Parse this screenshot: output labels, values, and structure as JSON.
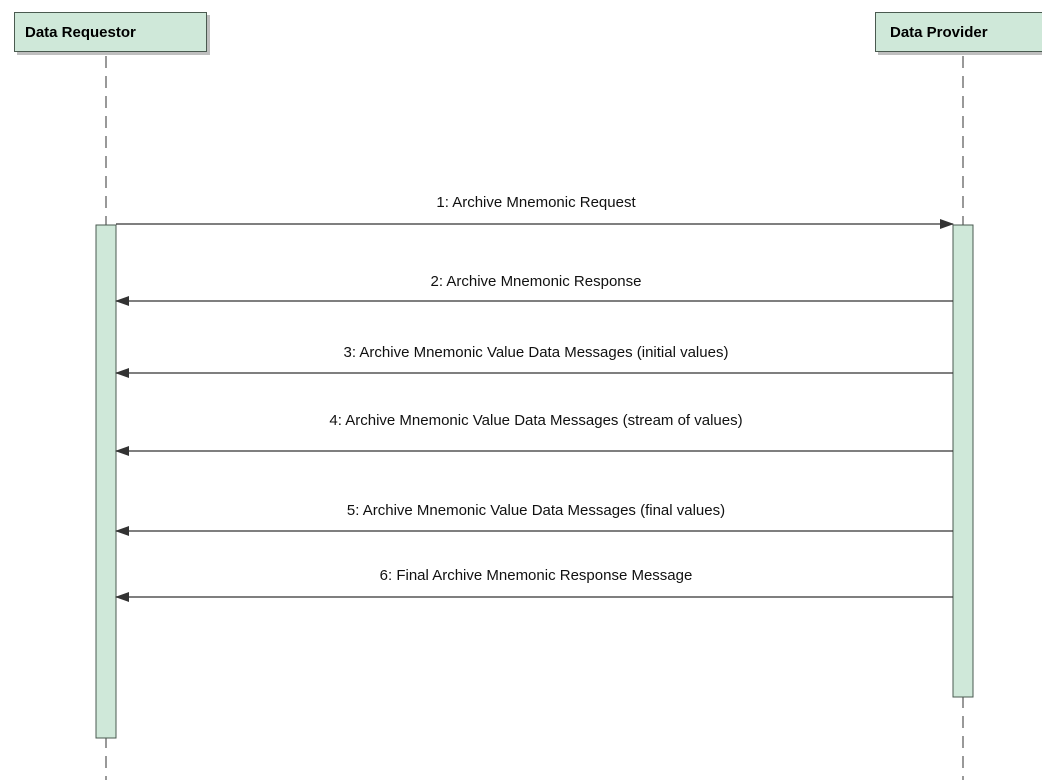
{
  "participants": {
    "requestor": {
      "label": "Data Requestor"
    },
    "provider": {
      "label": "Data Provider"
    }
  },
  "messages": [
    {
      "label": "1: Archive Mnemonic Request",
      "from": "requestor",
      "to": "provider"
    },
    {
      "label": "2: Archive Mnemonic Response",
      "from": "provider",
      "to": "requestor"
    },
    {
      "label": "3: Archive Mnemonic Value Data Messages (initial values)",
      "from": "provider",
      "to": "requestor"
    },
    {
      "label": "4: Archive Mnemonic Value Data Messages (stream of values)",
      "from": "provider",
      "to": "requestor"
    },
    {
      "label": "5: Archive Mnemonic Value Data Messages (final values)",
      "from": "provider",
      "to": "requestor"
    },
    {
      "label": "6: Final Archive Mnemonic Response Message",
      "from": "provider",
      "to": "requestor"
    }
  ],
  "colors": {
    "lifeline_fill": "#cfe8d9",
    "lifeline_border": "#4a5a50",
    "arrow": "#333333"
  }
}
